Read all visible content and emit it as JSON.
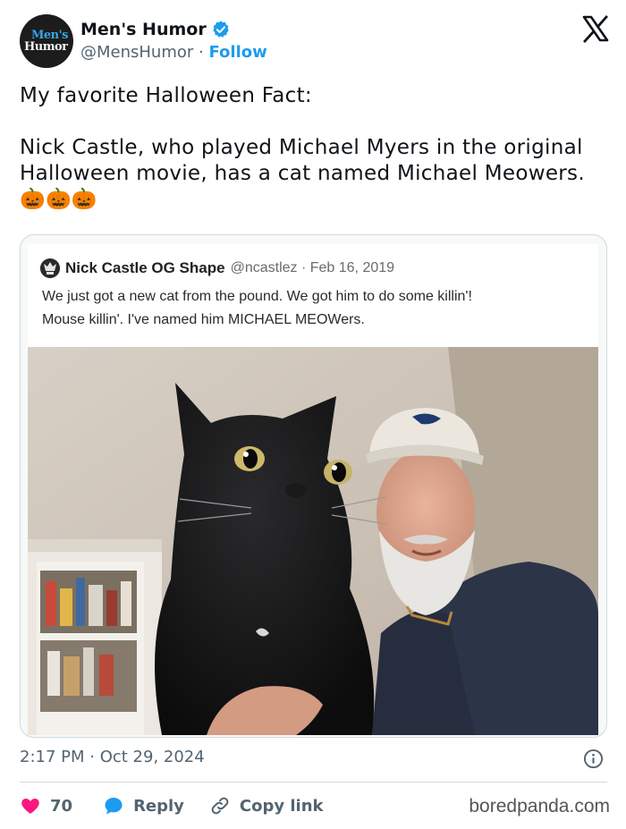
{
  "author": {
    "name": "Men's Humor",
    "handle": "@MensHumor",
    "separator": "·",
    "follow_label": "Follow",
    "avatar_text_top": "Men's",
    "avatar_text_bottom": "Humor"
  },
  "tweet": {
    "text": "My favorite Halloween Fact:\n\nNick Castle, who played Michael Myers in the original Halloween movie, has a cat named Michael Meowers. 🎃🎃🎃",
    "timestamp": "2:17 PM · Oct 29, 2024"
  },
  "quoted_tweet": {
    "name": "Nick Castle OG Shape",
    "handle": "@ncastlez · Feb 16, 2019",
    "text": "We just got a new cat from the pound.  We got him to do some killin'!\nMouse killin'.  I've named him MICHAEL MEOWers."
  },
  "actions": {
    "like_count": "70",
    "reply_label": "Reply",
    "copy_label": "Copy link"
  },
  "watermark": "boredpanda.com",
  "icons": [
    "verified-badge-icon",
    "x-logo-icon",
    "heart-icon",
    "reply-bubble-icon",
    "link-icon",
    "info-icon"
  ],
  "colors": {
    "accent": "#1d9bf0",
    "like": "#f91880",
    "text": "#0f1419",
    "muted": "#536471"
  }
}
